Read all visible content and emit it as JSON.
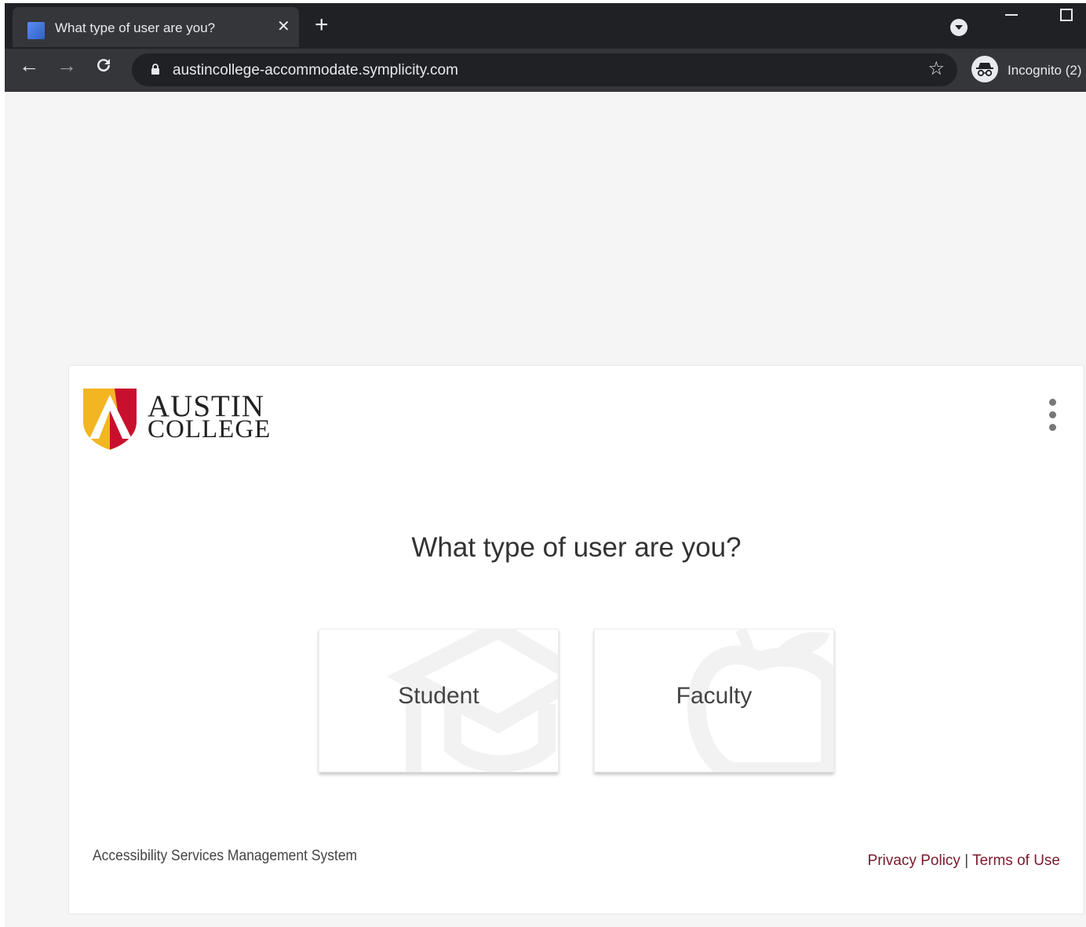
{
  "browser": {
    "tab_title": "What type of user are you?",
    "tab_close": "✕",
    "new_tab": "+",
    "url": "austincollege-accommodate.symplicity.com",
    "incognito_label": "Incognito (2)",
    "back": "←",
    "forward": "→",
    "reload": "C",
    "star": "☆"
  },
  "icons": {
    "favicon": "tab-favicon",
    "lock": "lock-icon",
    "star": "bookmark-star-icon",
    "incognito": "incognito-icon",
    "more": "kebab-menu-icon",
    "student_bg": "graduation-cap-icon",
    "faculty_bg": "apple-icon"
  },
  "logo": {
    "line1": "AUSTIN",
    "line2": "COLLEGE"
  },
  "main": {
    "question": "What type of user are you?",
    "choices": [
      {
        "label": "Student"
      },
      {
        "label": "Faculty"
      }
    ]
  },
  "footer": {
    "system_name": "Accessibility Services Management System",
    "privacy": "Privacy Policy",
    "separator": " | ",
    "terms": "Terms of Use"
  },
  "colors": {
    "shield_gold": "#f3b521",
    "shield_red": "#c8102e",
    "link": "#7a1a2c"
  }
}
